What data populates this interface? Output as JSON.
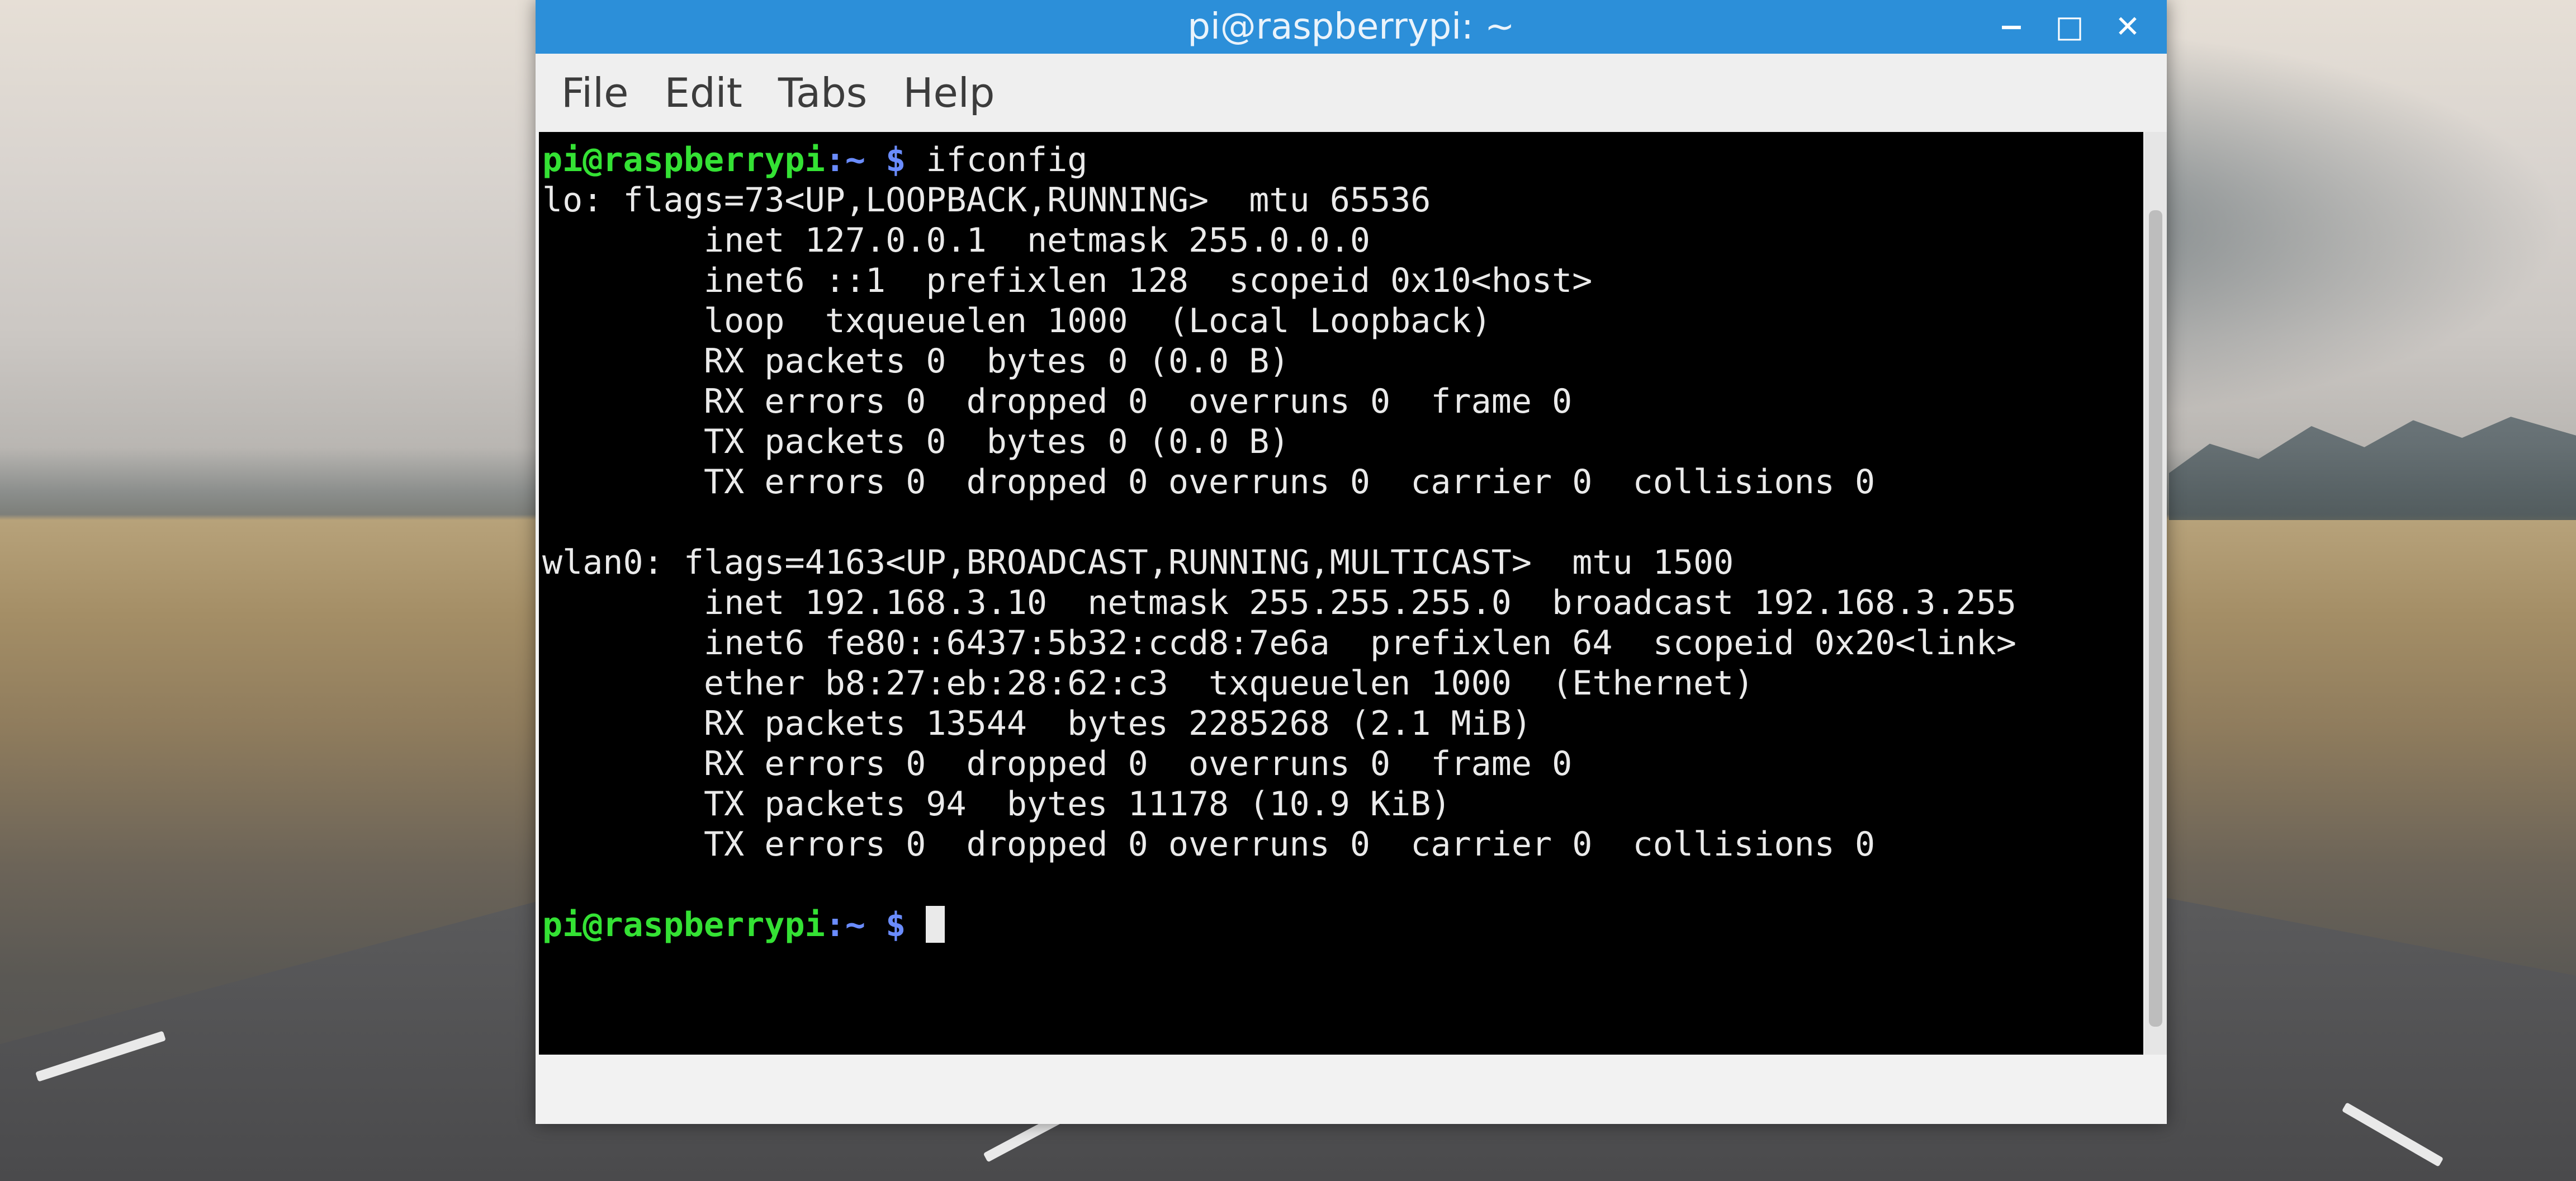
{
  "window": {
    "title": "pi@raspberrypi: ~",
    "controls": {
      "minimize": "−",
      "maximize": "□",
      "close": "✕"
    }
  },
  "menubar": {
    "items": [
      "File",
      "Edit",
      "Tabs",
      "Help"
    ]
  },
  "terminal": {
    "prompt_user": "pi@raspberrypi",
    "prompt_sep": ":",
    "prompt_path": "~ $",
    "command": "ifconfig",
    "output_lines": [
      "lo: flags=73<UP,LOOPBACK,RUNNING>  mtu 65536",
      "        inet 127.0.0.1  netmask 255.0.0.0",
      "        inet6 ::1  prefixlen 128  scopeid 0x10<host>",
      "        loop  txqueuelen 1000  (Local Loopback)",
      "        RX packets 0  bytes 0 (0.0 B)",
      "        RX errors 0  dropped 0  overruns 0  frame 0",
      "        TX packets 0  bytes 0 (0.0 B)",
      "        TX errors 0  dropped 0 overruns 0  carrier 0  collisions 0",
      "",
      "wlan0: flags=4163<UP,BROADCAST,RUNNING,MULTICAST>  mtu 1500",
      "        inet 192.168.3.10  netmask 255.255.255.0  broadcast 192.168.3.255",
      "        inet6 fe80::6437:5b32:ccd8:7e6a  prefixlen 64  scopeid 0x20<link>",
      "        ether b8:27:eb:28:62:c3  txqueuelen 1000  (Ethernet)",
      "        RX packets 13544  bytes 2285268 (2.1 MiB)",
      "        RX errors 0  dropped 0  overruns 0  frame 0",
      "        TX packets 94  bytes 11178 (10.9 KiB)",
      "        TX errors 0  dropped 0 overruns 0  carrier 0  collisions 0",
      ""
    ]
  },
  "colors": {
    "titlebar": "#2c8fd9",
    "terminal_bg": "#000000",
    "prompt_user": "#34e234",
    "prompt_path": "#6a8cff",
    "text": "#eaeaea"
  }
}
